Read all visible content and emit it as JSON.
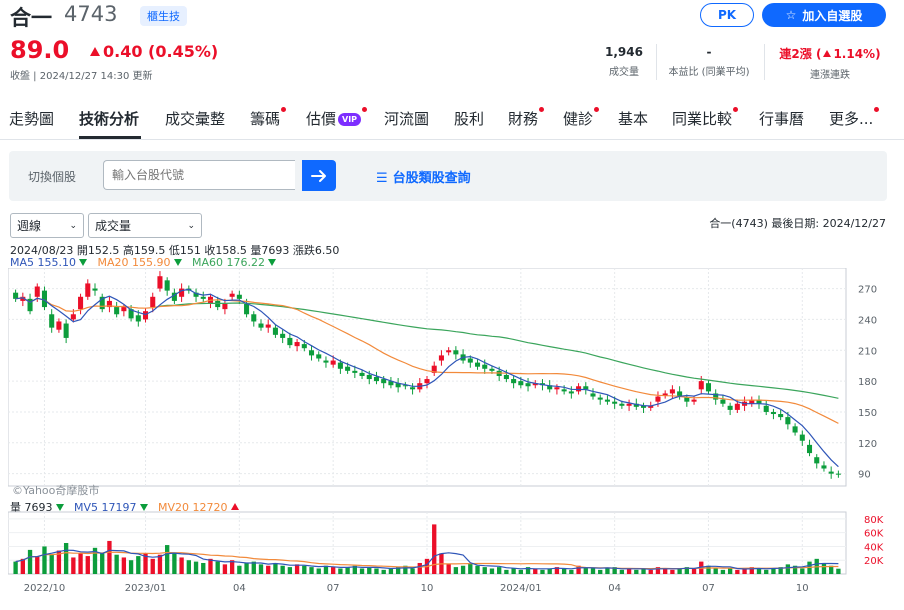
{
  "header": {
    "name": "合一",
    "code": "4743",
    "tag": "櫃生技",
    "pk_label": "PK",
    "add_label": "加入自選股"
  },
  "quote": {
    "price": "89.0",
    "change": "0.40 (0.45%)",
    "status": "收盤 | 2024/12/27 14:30 更新",
    "volume_value": "1,946",
    "volume_label": "成交量",
    "pe_value": "-",
    "pe_label": "本益比 (同業平均)",
    "streak_value": "連2漲 (",
    "streak_pct": "1.14%)",
    "streak_label": "連漲連跌"
  },
  "tabs": [
    {
      "label": "走勢圖",
      "dot": false
    },
    {
      "label": "技術分析",
      "dot": false,
      "active": true
    },
    {
      "label": "成交彙整",
      "dot": false
    },
    {
      "label": "籌碼",
      "dot": true
    },
    {
      "label": "估價",
      "dot": true,
      "vip": "VIP"
    },
    {
      "label": "河流圖",
      "dot": false
    },
    {
      "label": "股利",
      "dot": false
    },
    {
      "label": "財務",
      "dot": true
    },
    {
      "label": "健診",
      "dot": true
    },
    {
      "label": "基本",
      "dot": false
    },
    {
      "label": "同業比較",
      "dot": true
    },
    {
      "label": "行事曆",
      "dot": false
    },
    {
      "label": "更多...",
      "dot": true
    }
  ],
  "search": {
    "label": "切換個股",
    "placeholder": "輸入台股代號",
    "query_link": "台股類股查詢"
  },
  "controls": {
    "period": "週線",
    "indicator": "成交量"
  },
  "chart_meta": "合一(4743)   最後日期: 2024/12/27",
  "ohlc": "2024/08/23 開152.5 高159.5 低151 收158.5 量7693 漲跌6.50",
  "ma": {
    "ma5": "MA5 155.10",
    "ma20": "MA20 155.90",
    "ma60": "MA60 176.22"
  },
  "vol_info": {
    "vol": "量 7693",
    "mv5": "MV5 17197",
    "mv20": "MV20 12720"
  },
  "watermark": "©Yahoo奇摩股市",
  "colors": {
    "up": "#eb0f29",
    "down": "#0c9d3c",
    "accent": "#0f69ff",
    "ma5": "#2f56b8",
    "ma20": "#f28a3b",
    "ma60": "#3ba55c"
  },
  "chart_data": {
    "type": "candlestick",
    "price_axis": {
      "ticks": [
        90,
        120,
        150,
        180,
        210,
        240,
        270
      ],
      "ylim": [
        78,
        290
      ]
    },
    "volume_axis": {
      "ticks": [
        "20K",
        "40K",
        "60K",
        "80K"
      ],
      "ylim": [
        0,
        90000
      ]
    },
    "x_ticks": [
      "2022/10",
      "2023/01",
      "04",
      "07",
      "10",
      "2024/01",
      "04",
      "07",
      "10"
    ],
    "x_tick_index": [
      4,
      18,
      31,
      44,
      57,
      70,
      83,
      96,
      109
    ],
    "close": [
      260,
      262,
      248,
      272,
      252,
      232,
      238,
      222,
      245,
      262,
      275,
      268,
      250,
      258,
      245,
      252,
      241,
      238,
      248,
      262,
      282,
      268,
      258,
      270,
      268,
      262,
      260,
      262,
      252,
      255,
      265,
      260,
      245,
      238,
      232,
      235,
      225,
      222,
      215,
      218,
      212,
      205,
      202,
      198,
      200,
      192,
      190,
      188,
      185,
      182,
      180,
      178,
      176,
      174,
      175,
      172,
      178,
      182,
      195,
      205,
      210,
      206,
      200,
      198,
      194,
      192,
      190,
      185,
      182,
      178,
      176,
      175,
      178,
      176,
      172,
      174,
      170,
      168,
      175,
      172,
      165,
      162,
      160,
      158,
      156,
      158,
      155,
      154,
      156,
      165,
      168,
      172,
      165,
      160,
      162,
      180,
      170,
      162,
      158,
      152,
      158,
      160,
      162,
      158,
      150,
      148,
      145,
      138,
      130,
      122,
      110,
      100,
      95,
      90,
      89
    ],
    "open": [
      266,
      258,
      260,
      262,
      268,
      245,
      230,
      236,
      240,
      250,
      262,
      270,
      262,
      252,
      252,
      248,
      250,
      244,
      240,
      252,
      270,
      278,
      266,
      262,
      270,
      266,
      262,
      256,
      258,
      250,
      262,
      264,
      255,
      245,
      236,
      232,
      232,
      226,
      222,
      214,
      216,
      210,
      206,
      200,
      196,
      198,
      194,
      190,
      188,
      186,
      184,
      182,
      180,
      178,
      176,
      174,
      172,
      178,
      188,
      200,
      208,
      210,
      206,
      202,
      198,
      196,
      192,
      190,
      186,
      182,
      180,
      178,
      176,
      178,
      176,
      172,
      172,
      170,
      170,
      175,
      168,
      164,
      162,
      160,
      158,
      156,
      158,
      156,
      154,
      160,
      166,
      168,
      170,
      164,
      160,
      172,
      178,
      168,
      162,
      156,
      152,
      156,
      158,
      162,
      156,
      150,
      148,
      145,
      136,
      128,
      118,
      106,
      98,
      92,
      90
    ],
    "volume": [
      18000,
      22000,
      35000,
      26000,
      40000,
      28000,
      34000,
      45000,
      24000,
      30000,
      26000,
      38000,
      30000,
      48000,
      28000,
      24000,
      20000,
      26000,
      30000,
      22000,
      28000,
      42000,
      30000,
      24000,
      20000,
      18000,
      16000,
      22000,
      18000,
      14000,
      20000,
      12000,
      16000,
      18000,
      14000,
      12000,
      16000,
      12000,
      10000,
      14000,
      12000,
      10000,
      8000,
      12000,
      10000,
      8000,
      10000,
      12000,
      8000,
      10000,
      8000,
      6000,
      8000,
      10000,
      12000,
      8000,
      16000,
      22000,
      72000,
      30000,
      14000,
      10000,
      12000,
      16000,
      12000,
      10000,
      8000,
      10000,
      6000,
      8000,
      6000,
      10000,
      8000,
      6000,
      8000,
      10000,
      8000,
      6000,
      12000,
      10000,
      8000,
      6000,
      8000,
      10000,
      6000,
      8000,
      6000,
      8000,
      6000,
      10000,
      8000,
      6000,
      8000,
      10000,
      8000,
      18000,
      12000,
      8000,
      6000,
      8000,
      6000,
      8000,
      10000,
      8000,
      6000,
      8000,
      10000,
      14000,
      12000,
      8000,
      18000,
      22000,
      16000,
      12000,
      7693
    ]
  }
}
